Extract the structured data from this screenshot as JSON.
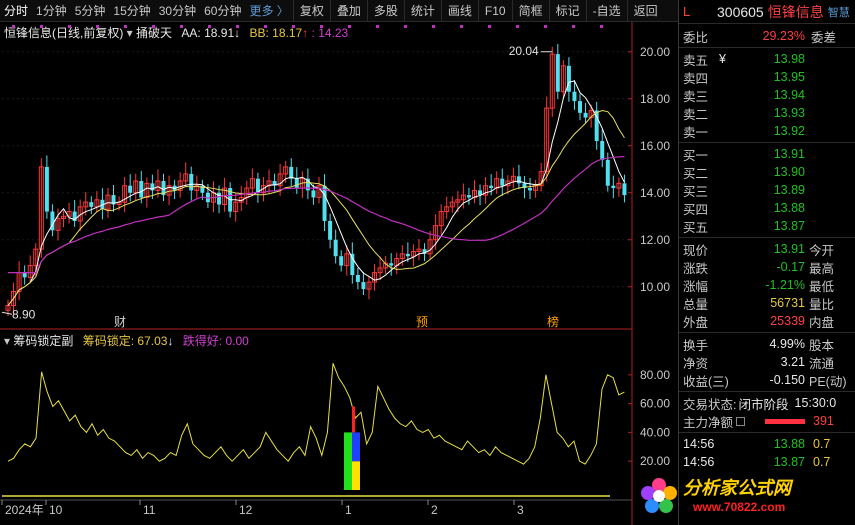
{
  "toolbar": {
    "periods": [
      "分时",
      "1分钟",
      "5分钟",
      "15分钟",
      "30分钟",
      "60分钟"
    ],
    "more": "更多 〉",
    "tools": [
      "复权",
      "叠加",
      "多股",
      "统计",
      "画线",
      "F10",
      "简框",
      "标记",
      "-自选",
      "返回"
    ]
  },
  "main_chart": {
    "stock_label": "恒锋信息(日线,前复权)",
    "indicator": "捅破天",
    "aa_label": "AA: 18.91",
    "bb_label": "BB: 18.17",
    "cc_label": ": 14.23",
    "y_ticks": [
      "20.00",
      "18.00",
      "16.00",
      "14.00",
      "12.00",
      "10.00"
    ],
    "high_label": "20.04",
    "low_label": "8.90",
    "events": [
      "财",
      "预",
      "榜"
    ]
  },
  "sub_chart": {
    "indicator": "筹码锁定副",
    "lock_label": "筹码锁定: 67.03",
    "drop_label": "跌得好: 0.00",
    "y_ticks": [
      "80.00",
      "60.00",
      "40.00",
      "20.00"
    ]
  },
  "x_axis": {
    "labels": [
      "2024年",
      "10",
      "11",
      "12",
      "1",
      "2",
      "3"
    ]
  },
  "quote": {
    "market": "L",
    "code": "300605",
    "name": "恒锋信息",
    "smart": "智慧",
    "weibi_label": "委比",
    "weibi_value": "29.23%",
    "weicha_label": "委差",
    "sell": [
      {
        "label": "卖五",
        "mark": "¥",
        "price": "13.98"
      },
      {
        "label": "卖四",
        "mark": "",
        "price": "13.95"
      },
      {
        "label": "卖三",
        "mark": "",
        "price": "13.94"
      },
      {
        "label": "卖二",
        "mark": "",
        "price": "13.93"
      },
      {
        "label": "卖一",
        "mark": "",
        "price": "13.92"
      }
    ],
    "buy": [
      {
        "label": "买一",
        "price": "13.91"
      },
      {
        "label": "买二",
        "price": "13.90"
      },
      {
        "label": "买三",
        "price": "13.89"
      },
      {
        "label": "买四",
        "price": "13.88"
      },
      {
        "label": "买五",
        "price": "13.87"
      }
    ],
    "stats": [
      {
        "l1": "现价",
        "v": "13.91",
        "l2": "今开",
        "color": "green"
      },
      {
        "l1": "涨跌",
        "v": "-0.17",
        "l2": "最高",
        "color": "green"
      },
      {
        "l1": "涨幅",
        "v": "-1.21%",
        "l2": "最低",
        "color": "green"
      },
      {
        "l1": "总量",
        "v": "56731",
        "l2": "量比",
        "color": "yellow"
      },
      {
        "l1": "外盘",
        "v": "25339",
        "l2": "内盘",
        "color": "red"
      }
    ],
    "stats2": [
      {
        "l1": "换手",
        "v": "4.99%",
        "l2": "股本"
      },
      {
        "l1": "净资",
        "v": "3.21",
        "l2": "流通"
      },
      {
        "l1": "收益(三)",
        "v": "-0.150",
        "l2": "PE(动)"
      }
    ],
    "status_label": "交易状态:",
    "status_value": "闭市阶段",
    "status_time": "15:30:0",
    "main_flow_label": "主力净额",
    "main_flow_value": "391",
    "ticks": [
      {
        "time": "14:56",
        "price": "13.88",
        "vol": "0.7"
      },
      {
        "time": "14:56",
        "price": "13.87",
        "vol": "0.7"
      }
    ],
    "watermark_text": "分析家公式网",
    "watermark_url": "www.70822.com"
  },
  "chart_data": {
    "type": "candlestick",
    "price_range": [
      8.5,
      20.5
    ],
    "closes": [
      9.2,
      9.8,
      10.6,
      10.4,
      10.9,
      11.6,
      15.1,
      13.2,
      12.4,
      12.9,
      13.0,
      13.2,
      12.8,
      13.4,
      13.6,
      13.4,
      13.7,
      13.3,
      13.9,
      13.5,
      13.6,
      14.3,
      14.0,
      14.5,
      13.8,
      14.4,
      14.1,
      14.5,
      13.9,
      14.3,
      14.1,
      14.5,
      14.8,
      14.1,
      14.3,
      14.0,
      13.6,
      14.0,
      13.5,
      14.2,
      13.2,
      13.6,
      13.8,
      14.2,
      14.6,
      14.0,
      14.3,
      14.5,
      14.3,
      14.8,
      15.1,
      14.6,
      14.2,
      14.6,
      14.1,
      13.8,
      14.3,
      12.8,
      12.0,
      11.3,
      10.9,
      11.4,
      10.5,
      10.2,
      9.9,
      10.2,
      10.6,
      10.8,
      11.0,
      10.9,
      11.2,
      11.4,
      11.3,
      11.5,
      11.6,
      11.4,
      12.0,
      12.6,
      13.2,
      13.4,
      13.6,
      13.7,
      13.9,
      13.8,
      14.1,
      13.9,
      14.3,
      14.2,
      14.6,
      14.3,
      14.5,
      14.7,
      14.4,
      14.2,
      14.1,
      14.3,
      14.9,
      17.6,
      19.9,
      18.3,
      19.4,
      18.3,
      17.9,
      17.4,
      17.2,
      17.5,
      16.2,
      15.4,
      14.3,
      14.2,
      14.4,
      13.9
    ],
    "lock_values": [
      20,
      22,
      28,
      32,
      30,
      36,
      82,
      68,
      58,
      62,
      55,
      48,
      52,
      44,
      40,
      46,
      38,
      42,
      36,
      34,
      30,
      26,
      24,
      28,
      22,
      26,
      24,
      20,
      22,
      26,
      24,
      38,
      46,
      32,
      28,
      24,
      22,
      26,
      30,
      24,
      20,
      24,
      28,
      22,
      26,
      30,
      40,
      34,
      28,
      24,
      20,
      26,
      30,
      24,
      44,
      36,
      24,
      40,
      88,
      78,
      72,
      64,
      50,
      54,
      32,
      40,
      72,
      64,
      56,
      50,
      46,
      44,
      48,
      42,
      40,
      42,
      36,
      38,
      34,
      32,
      30,
      28,
      34,
      30,
      26,
      28,
      24,
      30,
      26,
      24,
      22,
      20,
      18,
      22,
      30,
      50,
      80,
      60,
      40,
      36,
      30,
      34,
      20,
      18,
      24,
      32,
      70,
      80,
      78,
      66,
      68
    ]
  }
}
